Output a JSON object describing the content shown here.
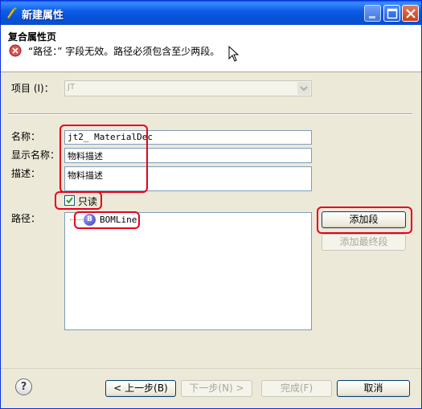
{
  "window": {
    "title": "新建属性"
  },
  "header": {
    "page_title": "复合属性页",
    "error_message": "“路径：” 字段无效。路径必须包含至少两段。"
  },
  "form": {
    "project_label": "项目 (I)：",
    "project_value": "JT",
    "name_label": "名称：",
    "name_value": "jt2_ MaterialDec",
    "display_name_label": "显示名称：",
    "display_name_value": "物料描述",
    "description_label": "描述：",
    "description_value": "物料描述",
    "readonly_label": "只读",
    "readonly_checked": true,
    "path_label": "路径：",
    "path_items": [
      "BOMLine"
    ],
    "path_item_icon_letter": "B"
  },
  "buttons": {
    "add_segment": "添加段",
    "add_final_segment": "添加最终段",
    "back": "< 上一步(B)",
    "next": "下一步(N) >",
    "finish": "完成(F)",
    "cancel": "取消",
    "help": "?"
  },
  "colors": {
    "highlight": "#e8001c",
    "title_bar": "#0a5ae0"
  }
}
